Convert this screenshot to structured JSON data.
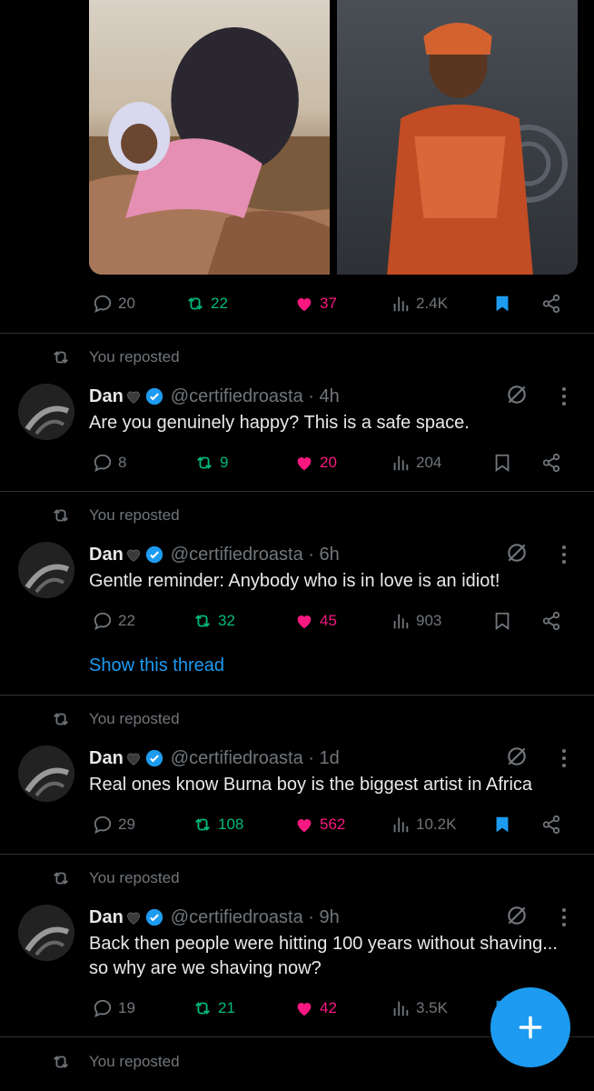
{
  "top_post": {
    "replies": "20",
    "reposts": "22",
    "likes": "37",
    "views": "2.4K",
    "bookmarked": true
  },
  "repost_label": "You reposted",
  "posts": [
    {
      "name": "Dan",
      "handle": "@certifiedroasta",
      "time": "· 4h",
      "text": "Are you genuinely happy? This is a safe space.",
      "replies": "8",
      "reposts": "9",
      "likes": "20",
      "views": "204",
      "bookmarked": false
    },
    {
      "name": "Dan",
      "handle": "@certifiedroasta",
      "time": "· 6h",
      "text": "Gentle reminder: Anybody who is in love is an idiot!",
      "replies": "22",
      "reposts": "32",
      "likes": "45",
      "views": "903",
      "bookmarked": false,
      "show_thread": "Show this thread"
    },
    {
      "name": "Dan",
      "handle": "@certifiedroasta",
      "time": "· 1d",
      "text": "Real ones know Burna boy is the biggest artist in Africa",
      "replies": "29",
      "reposts": "108",
      "likes": "562",
      "views": "10.2K",
      "bookmarked": true
    },
    {
      "name": "Dan",
      "handle": "@certifiedroasta",
      "time": "· 9h",
      "text": "Back then people were hitting 100 years without shaving...\nso why are we shaving now?",
      "replies": "19",
      "reposts": "21",
      "likes": "42",
      "views": "3.5K",
      "bookmarked": true
    }
  ],
  "colors": {
    "accent": "#1d9bf0",
    "repost": "#00ba7c",
    "like": "#f91880",
    "muted": "#71767b"
  },
  "icons": [
    "reply-icon",
    "repost-icon",
    "like-icon",
    "views-icon",
    "bookmark-icon",
    "share-icon",
    "grok-icon",
    "more-icon",
    "verified-icon",
    "compose-icon"
  ]
}
